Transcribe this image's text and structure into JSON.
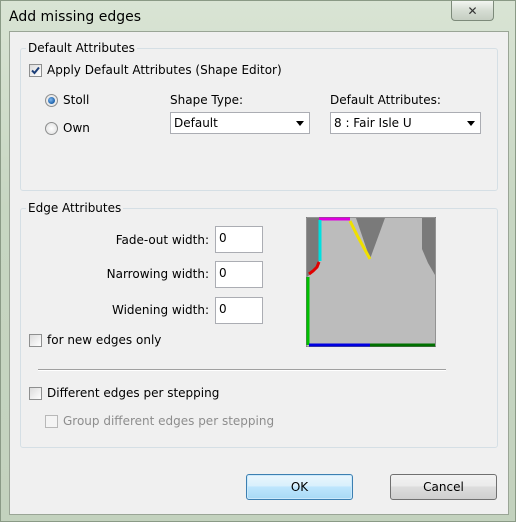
{
  "window": {
    "title": "Add missing edges",
    "close_glyph": "✕"
  },
  "default_attributes": {
    "group_label": "Default Attributes",
    "apply_checkbox_label": "Apply Default Attributes (Shape Editor)",
    "apply_checked": true,
    "radio_stoll_label": "Stoll",
    "radio_own_label": "Own",
    "selected_radio": "Stoll",
    "shape_type_label": "Shape Type:",
    "shape_type_value": "Default",
    "default_attr_label": "Default Attributes:",
    "default_attr_value": "8 : Fair Isle U"
  },
  "edge_attributes": {
    "group_label": "Edge Attributes",
    "fade_out_label": "Fade-out width:",
    "fade_out_value": "0",
    "narrowing_label": "Narrowing width:",
    "narrowing_value": "0",
    "widening_label": "Widening width:",
    "widening_value": "0",
    "new_edges_only_label": "for new edges only",
    "new_edges_only_checked": false,
    "different_edges_label": "Different edges per stepping",
    "different_edges_checked": false,
    "group_different_label": "Group different edges per stepping",
    "group_different_checked": false,
    "group_different_enabled": false
  },
  "preview_colors": {
    "background": "#bcbcbc",
    "dark": "#7a7a7a",
    "magenta": "#e000e0",
    "cyan": "#00e0e0",
    "yellow": "#f0e000",
    "red": "#e00000",
    "green": "#00c000",
    "blue": "#0000e0",
    "darkgreen": "#007000"
  },
  "buttons": {
    "ok_label": "OK",
    "cancel_label": "Cancel"
  }
}
